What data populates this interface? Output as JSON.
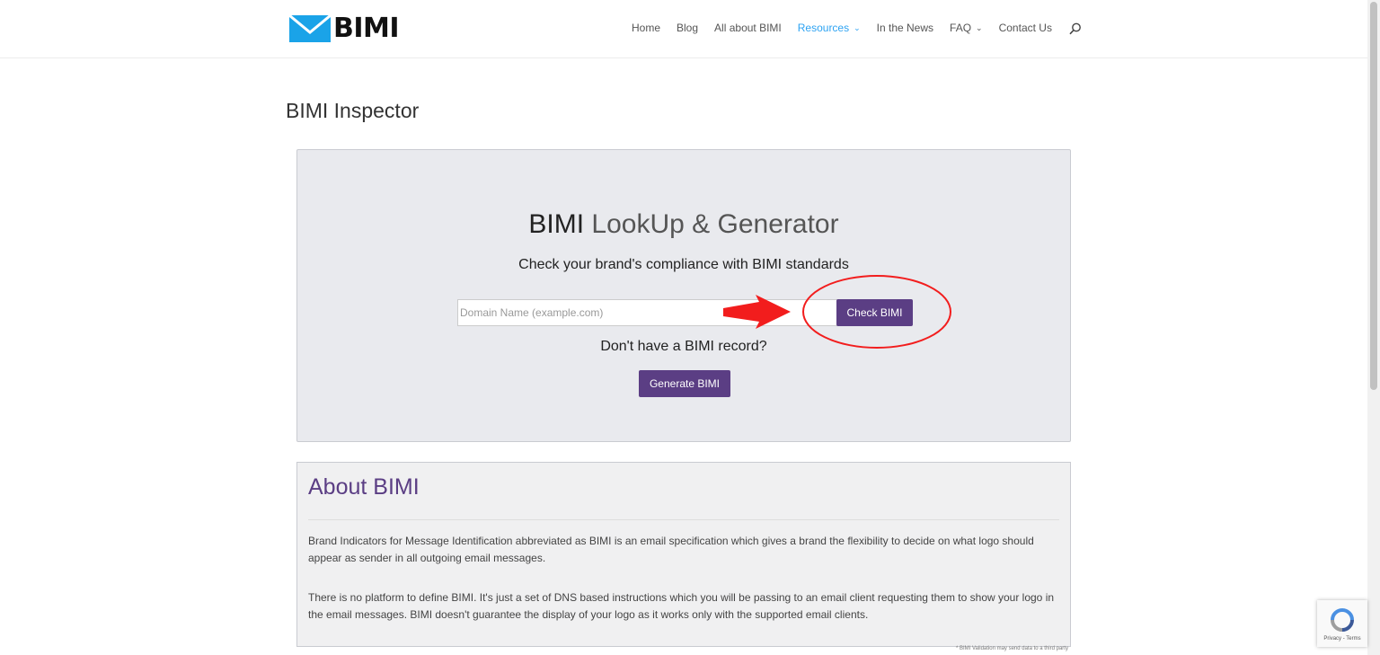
{
  "header": {
    "logo_text": "BIMI",
    "nav": [
      {
        "label": "Home"
      },
      {
        "label": "Blog"
      },
      {
        "label": "All about BIMI"
      },
      {
        "label": "Resources",
        "has_dropdown": true,
        "active": true
      },
      {
        "label": "In the News"
      },
      {
        "label": "FAQ",
        "has_dropdown": true
      },
      {
        "label": "Contact Us"
      }
    ],
    "search_icon": "search-icon"
  },
  "page": {
    "title": "BIMI Inspector"
  },
  "inspector": {
    "heading_strong": "BIMI",
    "heading_light": "LookUp & Generator",
    "subtitle": "Check your brand's compliance with BIMI standards",
    "domain_input": {
      "value": "",
      "placeholder": "Domain Name (example.com)"
    },
    "check_button": "Check BIMI",
    "no_record_text": "Don't have a BIMI record?",
    "generate_button": "Generate BIMI"
  },
  "about": {
    "title": "About BIMI",
    "paragraphs": [
      "Brand Indicators for Message Identification abbreviated as BIMI is an email specification which gives a brand the flexibility to decide on what logo should appear as sender in all outgoing email messages.",
      "There is no platform to define BIMI. It's just a set of DNS based instructions which you will be passing to an email client requesting them to show your logo in the email messages. BIMI doesn't guarantee the display of your logo as it works only with the supported email clients."
    ]
  },
  "footnote": "* BIMI Validation may send data to a third party",
  "recaptcha": {
    "links": "Privacy - Terms"
  },
  "colors": {
    "brand_purple": "#5b3e84",
    "nav_active": "#2ea3f2",
    "logo_blue": "#1aa3e8",
    "annotation_red": "#f21d1d",
    "panel_bg": "#e9eaee"
  }
}
